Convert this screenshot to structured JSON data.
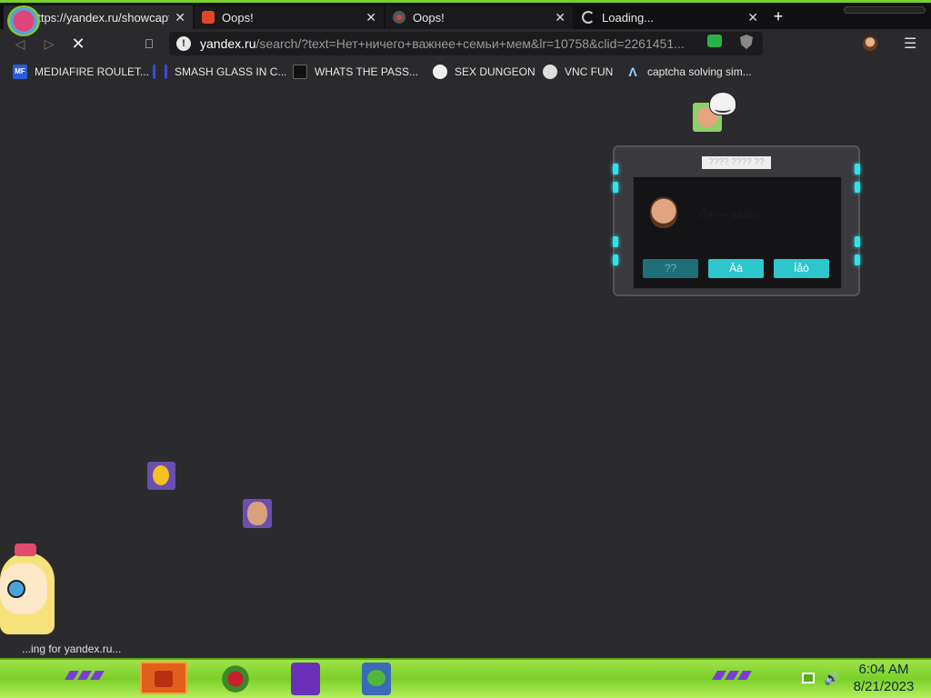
{
  "tabs": [
    {
      "title": "https://yandex.ru/showcaptcha",
      "icon": "yandex-captcha-icon"
    },
    {
      "title": "Oops!",
      "icon": "yandex-icon"
    },
    {
      "title": "Oops!",
      "icon": "swirl-icon"
    },
    {
      "title": "Loading...",
      "icon": "loading-spinner-icon"
    }
  ],
  "tab_close": "✕",
  "new_tab": "+",
  "address": {
    "domain": "yandex.ru",
    "path": "/search/?text=Нет+ничего+важнее+семьи+мем&lr=10758&clid=2261451..."
  },
  "bookmarks": [
    {
      "label": "MEDIAFIRE ROULET...",
      "icon": "mediafire-icon",
      "icon_text": "MF",
      "color": "#2a5bd7"
    },
    {
      "label": "SMASH GLASS IN C...",
      "icon": "smash-glass-icon",
      "icon_text": "",
      "color": "#3a4ad8"
    },
    {
      "label": "WHATS THE PASS...",
      "icon": "lock-icon",
      "icon_text": "",
      "color": "#111111"
    },
    {
      "label": "SEX DUNGEON",
      "icon": "dungeon-icon",
      "icon_text": "",
      "color": "#eeeeee"
    },
    {
      "label": "VNC FUN",
      "icon": "vnc-icon",
      "icon_text": "",
      "color": "#dddddd"
    },
    {
      "label": "captcha solving sim...",
      "icon": "captcha-lambda-icon",
      "icon_text": "Λ",
      "color": "#2a2a2c"
    }
  ],
  "dialog": {
    "title": "???? ???? ??",
    "message": "Ôà — äèàëîí",
    "buttons": [
      "??",
      "Äà",
      "Íåò"
    ]
  },
  "status_text": "...ing for yandex.ru...",
  "clock": {
    "time": "6:04 AM",
    "date": "8/21/2023"
  },
  "colors": {
    "taskbar": "#7ccf2a",
    "accent_cyan": "#2cc6cc"
  }
}
